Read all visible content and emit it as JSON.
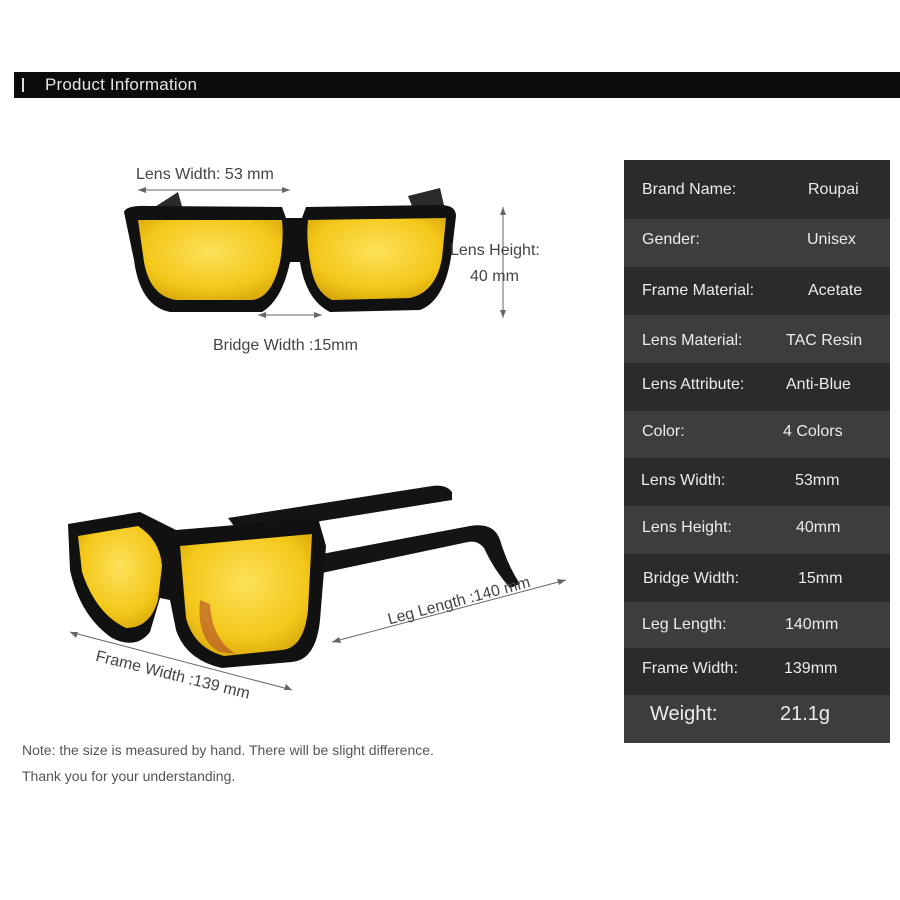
{
  "header": {
    "title": "Product Information"
  },
  "specs": [
    {
      "key": "Brand Name:",
      "value": "Roupai"
    },
    {
      "key": "Gender:",
      "value": "Unisex"
    },
    {
      "key": "Frame Material:",
      "value": "Acetate"
    },
    {
      "key": "Lens Material:",
      "value": "TAC Resin"
    },
    {
      "key": "Lens Attribute:",
      "value": "Anti-Blue"
    },
    {
      "key": "Color:",
      "value": "4 Colors"
    },
    {
      "key": "Lens Width:",
      "value": "53mm"
    },
    {
      "key": "Lens Height:",
      "value": "40mm"
    },
    {
      "key": "Bridge Width:",
      "value": "15mm"
    },
    {
      "key": "Leg Length:",
      "value": "140mm"
    },
    {
      "key": "Frame Width:",
      "value": "139mm"
    },
    {
      "key": "Weight:",
      "value": "21.1g"
    }
  ],
  "dimensions": {
    "lens_width": "Lens Width: 53 mm",
    "lens_height_line1": "Lens Height:",
    "lens_height_line2": "40 mm",
    "bridge_width": "Bridge Width :15mm",
    "leg_length": "Leg Length :140 mm",
    "frame_width": "Frame Width :139 mm"
  },
  "note": {
    "line1": "Note: the size is measured by hand. There will be slight difference.",
    "line2": "Thank you for your understanding."
  },
  "colors": {
    "lens_yellow": "#f7d21e",
    "frame_black": "#111111",
    "table_dark": "#2b2b2b",
    "table_light": "#3d3d3d"
  }
}
